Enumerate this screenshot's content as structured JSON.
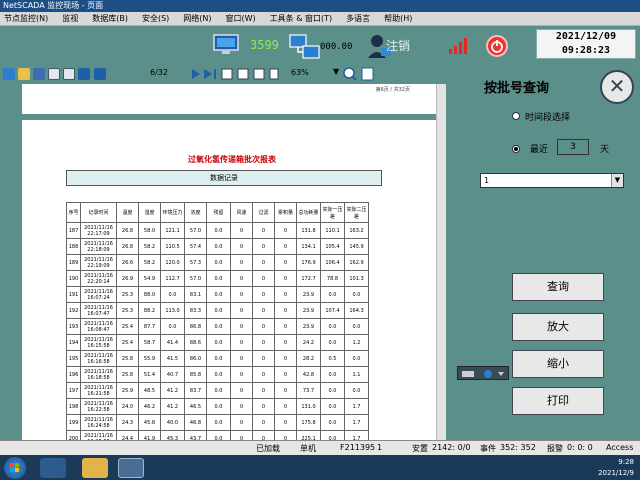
{
  "window": {
    "title": "NetSCADA 监控现场 - 页面"
  },
  "menu": [
    {
      "label": "节点监控(N)"
    },
    {
      "label": "监视"
    },
    {
      "label": "数据库(B)"
    },
    {
      "label": "安全(S)"
    },
    {
      "label": "网络(N)"
    },
    {
      "label": "窗口(W)"
    },
    {
      "label": "工具条 & 窗口(T)"
    },
    {
      "label": "多语言"
    },
    {
      "label": "帮助(H)"
    }
  ],
  "status": {
    "node_count": "3599",
    "net_value": "000.00",
    "logout_label": "注销",
    "date": "2021/12/09",
    "time": "09:28:23"
  },
  "viewer": {
    "page_info": "6/32",
    "zoom": "63%",
    "page_label": "第6页 / 共32页",
    "report_title": "过氧化氢传递箱批次报表",
    "report_header": "数据记录",
    "columns": [
      "序号",
      "记录时间",
      "温度",
      "湿度",
      "环境压力",
      "浓度",
      "残留",
      "风速",
      "过滤",
      "累积量",
      "总功耗量",
      "实际一压差",
      "实际二压差"
    ],
    "rows": [
      [
        "187",
        "2021/11/16 22:17:09",
        "26.8",
        "58.0",
        "121.1",
        "57.0",
        "0.0",
        "0",
        "0",
        "0",
        "131.8",
        "110.1",
        "163.2"
      ],
      [
        "188",
        "2021/11/16 22:18:09",
        "26.8",
        "58.2",
        "110.5",
        "57.4",
        "0.0",
        "0",
        "0",
        "0",
        "134.1",
        "105.4",
        "145.9"
      ],
      [
        "189",
        "2021/11/16 22:19:09",
        "26.6",
        "58.2",
        "120.0",
        "57.3",
        "0.0",
        "0",
        "0",
        "0",
        "176.9",
        "106.4",
        "162.9"
      ],
      [
        "190",
        "2021/11/16 22:20:14",
        "26.9",
        "54.9",
        "112.7",
        "57.0",
        "0.0",
        "0",
        "0",
        "0",
        "172.7",
        "78.8",
        "101.3"
      ],
      [
        "191",
        "2021/11/16 16:07:24",
        "25.3",
        "88.0",
        "0.0",
        "83.1",
        "0.0",
        "0",
        "0",
        "0",
        "23.9",
        "0.0",
        "0.0"
      ],
      [
        "192",
        "2021/11/16 16:07:47",
        "25.3",
        "88.2",
        "113.0",
        "83.3",
        "0.0",
        "0",
        "0",
        "0",
        "23.9",
        "107.4",
        "164.3"
      ],
      [
        "193",
        "2021/11/16 16:08:47",
        "25.4",
        "87.7",
        "0.0",
        "86.8",
        "0.0",
        "0",
        "0",
        "0",
        "23.9",
        "0.0",
        "0.0"
      ],
      [
        "194",
        "2021/11/16 16:15:58",
        "25.4",
        "58.7",
        "41.4",
        "88.6",
        "0.0",
        "0",
        "0",
        "0",
        "24.2",
        "0.0",
        "1.2"
      ],
      [
        "195",
        "2021/11/16 16:16:58",
        "25.8",
        "55.9",
        "41.5",
        "86.0",
        "0.0",
        "0",
        "0",
        "0",
        "28.2",
        "0.5",
        "0.0"
      ],
      [
        "196",
        "2021/11/16 16:18:58",
        "25.8",
        "51.4",
        "40.7",
        "85.8",
        "0.0",
        "0",
        "0",
        "0",
        "42.8",
        "0.0",
        "1.1"
      ],
      [
        "197",
        "2021/11/16 16:21:58",
        "25.9",
        "48.5",
        "41.2",
        "83.7",
        "0.0",
        "0",
        "0",
        "0",
        "73.7",
        "0.0",
        "0.0"
      ],
      [
        "198",
        "2021/11/16 16:22:58",
        "24.0",
        "46.2",
        "41.2",
        "46.5",
        "0.0",
        "0",
        "0",
        "0",
        "131.0",
        "0.0",
        "1.7"
      ],
      [
        "199",
        "2021/11/16 16:24:58",
        "24.3",
        "45.8",
        "40.0",
        "46.8",
        "0.0",
        "0",
        "0",
        "0",
        "175.8",
        "0.0",
        "1.7"
      ],
      [
        "200",
        "2021/11/16 16:25:58",
        "24.4",
        "41.9",
        "45.3",
        "43.7",
        "0.0",
        "0",
        "0",
        "0",
        "225.1",
        "0.0",
        "1.7"
      ],
      [
        "201",
        "2021/11/16 16:26:58",
        "24.8",
        "39.8",
        "42.9",
        "41.7",
        "0.0",
        "0",
        "0",
        "0",
        "284.7",
        "0.0",
        "1.0"
      ],
      [
        "202",
        "2021/11/16 16:27:58",
        "24.8",
        "37.6",
        "42.5",
        "39.8",
        "0.0",
        "0",
        "0",
        "0",
        "275.1",
        "0.0",
        "0.7"
      ]
    ]
  },
  "panel": {
    "title": "按批号查询",
    "radio_time": "时间段选择",
    "radio_recent": "最近",
    "days_value": "3",
    "days_unit": "天",
    "batch_value": "1",
    "btn_query": "查询",
    "btn_zoom_in": "放大",
    "btn_zoom_out": "缩小",
    "btn_print": "打印"
  },
  "statusbar": {
    "loaded": "已加载",
    "mode": "单机",
    "code": "F211395",
    "count1": "1",
    "security": "安置",
    "sec_val": "2142: 0/0",
    "events": "事件",
    "ev_val": "352: 352",
    "alarms": "报警",
    "al_val": "0: 0: 0",
    "access": "Access"
  },
  "systray": {
    "time": "9:28",
    "date": "2021/12/9"
  },
  "colors": {
    "bg": "#5b8f8a",
    "clock_text": "#000000",
    "title_red": "#cc0000"
  }
}
